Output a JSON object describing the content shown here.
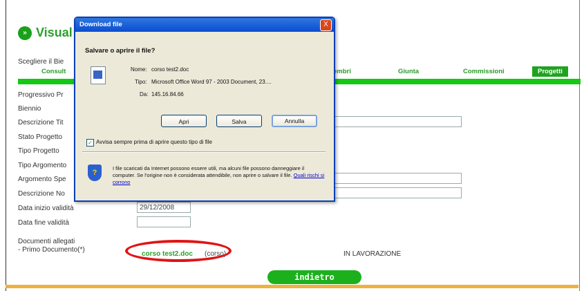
{
  "page": {
    "title": "Visual",
    "choose_label": "Scegliere il Bie",
    "tabs": [
      {
        "label": "Consult",
        "active": false
      },
      {
        "label": "embri",
        "active": false
      },
      {
        "label": "Giunta",
        "active": false
      },
      {
        "label": "Commissioni",
        "active": false
      },
      {
        "label": "Progetti",
        "active": true
      }
    ],
    "form_labels": {
      "progressivo": "Progressivo Pr",
      "biennio": "Biennio",
      "descrizione_titolo": "Descrizione Tit",
      "stato_progetto": "Stato Progetto",
      "tipo_progetto": "Tipo Progetto",
      "tipo_argomento": "Tipo Argomento",
      "argomento_spec": "Argomento Spe",
      "descrizione_note": "Descrizione No",
      "data_inizio": "Data inizio validità",
      "data_fine": "Data fine validità"
    },
    "data_inizio_value": "29/12/2008",
    "data_fine_value": "",
    "documents_label_1": "Documenti allegati",
    "documents_label_2": "- Primo Documento(*)",
    "document_link": "corso test2.doc",
    "document_suffix": "(corso)",
    "status": "IN LAVORAZIONE",
    "back_button": "indietro"
  },
  "dialog": {
    "title": "Download file",
    "close_label": "X",
    "question": "Salvare o aprire il file?",
    "name_label": "Nome:",
    "name_value": "corso test2.doc",
    "type_label": "Tipo:",
    "type_value": "Microsoft Office Word 97 - 2003 Document, 23....",
    "from_label": "Da:",
    "from_value": "145.16.84.66",
    "open_button": "Apri",
    "save_button": "Salva",
    "cancel_button": "Annulla",
    "checkbox_label": "Avvisa sempre prima di aprire questo tipo di file",
    "checkbox_checked": true,
    "checkbox_mark": "✓",
    "warning_text": "I file scaricati da Internet possono essere utili, ma alcuni file possono danneggiare il computer. Se l'origine non è considerata attendibile, non aprire o salvare il file.",
    "warning_link": "Quali rischi si corrono",
    "shield_mark": "?"
  },
  "icons": {
    "title_icon": "double-arrow-icon",
    "title_icon_glyph": "»",
    "file_icon": "word-document-icon",
    "shield_icon": "security-shield-icon"
  },
  "colors": {
    "accent_green": "#2aa02a",
    "tab_bar_green": "#15c815",
    "dialog_blue": "#0a4cd0",
    "highlight_red": "#e01414",
    "footer_orange": "#f0b040"
  }
}
